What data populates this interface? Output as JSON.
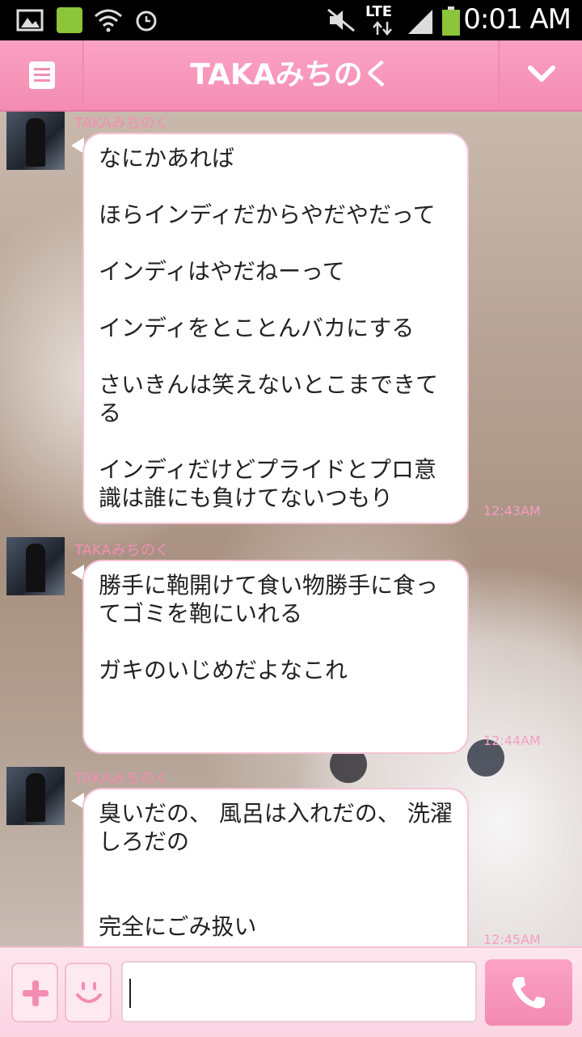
{
  "status_bar": {
    "time": "0:01 AM",
    "network": "LTE"
  },
  "header": {
    "title": "TAKAみちのく",
    "menu_icon": "menu-icon",
    "dropdown_icon": "chevron-down-icon"
  },
  "messages": [
    {
      "sender": "TAKAみちのく",
      "text": "なにかあれば\n\nほらインディだからやだやだって\n\nインディはやだねーって\n\nインディをとことんバカにする\n\nさいきんは笑えないとこまできてる\n\nインディだけどプライドとプロ意識は誰にも負けてないつもり",
      "time": "12:43AM"
    },
    {
      "sender": "TAKAみちのく",
      "text": "勝手に鞄開けて食い物勝手に食ってゴミを鞄にいれる\n\nガキのいじめだよなこれ\n\n",
      "time": "12:44AM"
    },
    {
      "sender": "TAKAみちのく",
      "text": "臭いだの、 風呂は入れだの、 洗濯しろだの\n\n\n完全にごみ扱い",
      "time": "12:45AM"
    }
  ],
  "input_bar": {
    "placeholder": "",
    "plus_icon": "plus-icon",
    "emoji_icon": "emoji-icon",
    "call_icon": "phone-icon"
  },
  "colors": {
    "accent": "#f48db3",
    "bubble_border": "#f6c3d6"
  }
}
